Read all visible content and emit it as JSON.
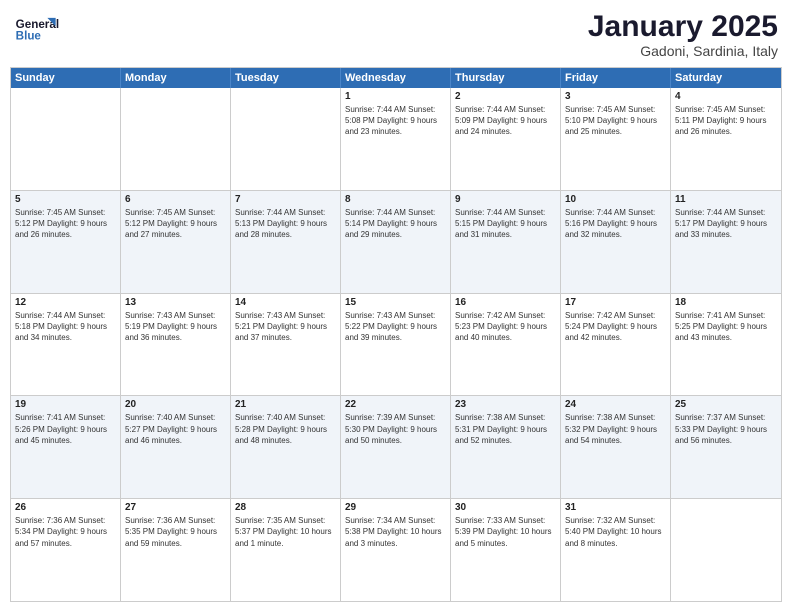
{
  "header": {
    "logo_line1": "General",
    "logo_line2": "Blue",
    "title": "January 2025",
    "subtitle": "Gadoni, Sardinia, Italy"
  },
  "days_of_week": [
    "Sunday",
    "Monday",
    "Tuesday",
    "Wednesday",
    "Thursday",
    "Friday",
    "Saturday"
  ],
  "weeks": [
    [
      {
        "day": "",
        "text": ""
      },
      {
        "day": "",
        "text": ""
      },
      {
        "day": "",
        "text": ""
      },
      {
        "day": "1",
        "text": "Sunrise: 7:44 AM\nSunset: 5:08 PM\nDaylight: 9 hours\nand 23 minutes."
      },
      {
        "day": "2",
        "text": "Sunrise: 7:44 AM\nSunset: 5:09 PM\nDaylight: 9 hours\nand 24 minutes."
      },
      {
        "day": "3",
        "text": "Sunrise: 7:45 AM\nSunset: 5:10 PM\nDaylight: 9 hours\nand 25 minutes."
      },
      {
        "day": "4",
        "text": "Sunrise: 7:45 AM\nSunset: 5:11 PM\nDaylight: 9 hours\nand 26 minutes."
      }
    ],
    [
      {
        "day": "5",
        "text": "Sunrise: 7:45 AM\nSunset: 5:12 PM\nDaylight: 9 hours\nand 26 minutes."
      },
      {
        "day": "6",
        "text": "Sunrise: 7:45 AM\nSunset: 5:12 PM\nDaylight: 9 hours\nand 27 minutes."
      },
      {
        "day": "7",
        "text": "Sunrise: 7:44 AM\nSunset: 5:13 PM\nDaylight: 9 hours\nand 28 minutes."
      },
      {
        "day": "8",
        "text": "Sunrise: 7:44 AM\nSunset: 5:14 PM\nDaylight: 9 hours\nand 29 minutes."
      },
      {
        "day": "9",
        "text": "Sunrise: 7:44 AM\nSunset: 5:15 PM\nDaylight: 9 hours\nand 31 minutes."
      },
      {
        "day": "10",
        "text": "Sunrise: 7:44 AM\nSunset: 5:16 PM\nDaylight: 9 hours\nand 32 minutes."
      },
      {
        "day": "11",
        "text": "Sunrise: 7:44 AM\nSunset: 5:17 PM\nDaylight: 9 hours\nand 33 minutes."
      }
    ],
    [
      {
        "day": "12",
        "text": "Sunrise: 7:44 AM\nSunset: 5:18 PM\nDaylight: 9 hours\nand 34 minutes."
      },
      {
        "day": "13",
        "text": "Sunrise: 7:43 AM\nSunset: 5:19 PM\nDaylight: 9 hours\nand 36 minutes."
      },
      {
        "day": "14",
        "text": "Sunrise: 7:43 AM\nSunset: 5:21 PM\nDaylight: 9 hours\nand 37 minutes."
      },
      {
        "day": "15",
        "text": "Sunrise: 7:43 AM\nSunset: 5:22 PM\nDaylight: 9 hours\nand 39 minutes."
      },
      {
        "day": "16",
        "text": "Sunrise: 7:42 AM\nSunset: 5:23 PM\nDaylight: 9 hours\nand 40 minutes."
      },
      {
        "day": "17",
        "text": "Sunrise: 7:42 AM\nSunset: 5:24 PM\nDaylight: 9 hours\nand 42 minutes."
      },
      {
        "day": "18",
        "text": "Sunrise: 7:41 AM\nSunset: 5:25 PM\nDaylight: 9 hours\nand 43 minutes."
      }
    ],
    [
      {
        "day": "19",
        "text": "Sunrise: 7:41 AM\nSunset: 5:26 PM\nDaylight: 9 hours\nand 45 minutes."
      },
      {
        "day": "20",
        "text": "Sunrise: 7:40 AM\nSunset: 5:27 PM\nDaylight: 9 hours\nand 46 minutes."
      },
      {
        "day": "21",
        "text": "Sunrise: 7:40 AM\nSunset: 5:28 PM\nDaylight: 9 hours\nand 48 minutes."
      },
      {
        "day": "22",
        "text": "Sunrise: 7:39 AM\nSunset: 5:30 PM\nDaylight: 9 hours\nand 50 minutes."
      },
      {
        "day": "23",
        "text": "Sunrise: 7:38 AM\nSunset: 5:31 PM\nDaylight: 9 hours\nand 52 minutes."
      },
      {
        "day": "24",
        "text": "Sunrise: 7:38 AM\nSunset: 5:32 PM\nDaylight: 9 hours\nand 54 minutes."
      },
      {
        "day": "25",
        "text": "Sunrise: 7:37 AM\nSunset: 5:33 PM\nDaylight: 9 hours\nand 56 minutes."
      }
    ],
    [
      {
        "day": "26",
        "text": "Sunrise: 7:36 AM\nSunset: 5:34 PM\nDaylight: 9 hours\nand 57 minutes."
      },
      {
        "day": "27",
        "text": "Sunrise: 7:36 AM\nSunset: 5:35 PM\nDaylight: 9 hours\nand 59 minutes."
      },
      {
        "day": "28",
        "text": "Sunrise: 7:35 AM\nSunset: 5:37 PM\nDaylight: 10 hours\nand 1 minute."
      },
      {
        "day": "29",
        "text": "Sunrise: 7:34 AM\nSunset: 5:38 PM\nDaylight: 10 hours\nand 3 minutes."
      },
      {
        "day": "30",
        "text": "Sunrise: 7:33 AM\nSunset: 5:39 PM\nDaylight: 10 hours\nand 5 minutes."
      },
      {
        "day": "31",
        "text": "Sunrise: 7:32 AM\nSunset: 5:40 PM\nDaylight: 10 hours\nand 8 minutes."
      },
      {
        "day": "",
        "text": ""
      }
    ]
  ]
}
